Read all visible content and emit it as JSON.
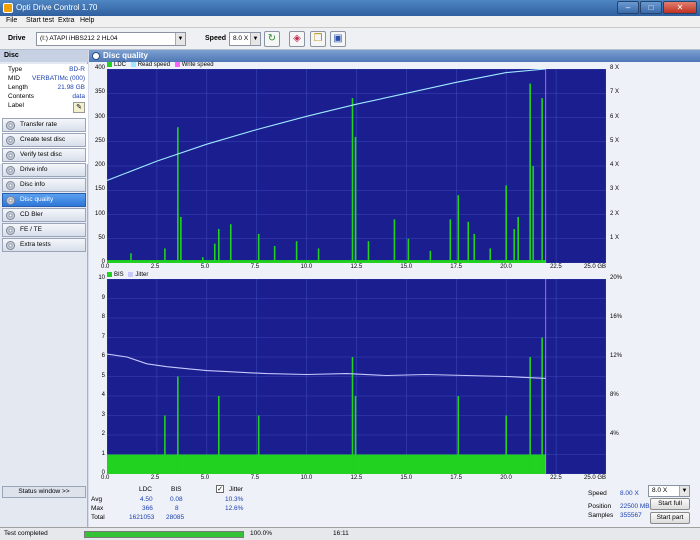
{
  "window": {
    "title": "Opti Drive Control 1.70",
    "minimize": "–",
    "maximize": "□",
    "close": "✕"
  },
  "menu": [
    "File",
    "Start test",
    "Extra",
    "Help"
  ],
  "toolbar": {
    "drive_label": "Drive",
    "drive_value": "(I:)  ATAPI iHBS212   2 HL04",
    "speed_label": "Speed",
    "speed_value": "8.0 X",
    "refresh_icon": "refresh-icon",
    "erase_icon": "erase-icon",
    "copy_icon": "copy-icon",
    "save_icon": "save-icon"
  },
  "sidebar": {
    "header": "Disc",
    "info": [
      {
        "key": "Type",
        "value": "BD-R"
      },
      {
        "key": "MID",
        "value": "VERBATIMc (000)"
      },
      {
        "key": "Length",
        "value": "21.98 GB"
      },
      {
        "key": "Contents",
        "value": "data"
      },
      {
        "key": "Label",
        "value": ""
      }
    ],
    "nav": [
      {
        "label": "Transfer rate",
        "active": false
      },
      {
        "label": "Create test disc",
        "active": false
      },
      {
        "label": "Verify test disc",
        "active": false
      },
      {
        "label": "Drive info",
        "active": false
      },
      {
        "label": "Disc info",
        "active": false
      },
      {
        "label": "Disc quality",
        "active": true
      },
      {
        "label": "CD Bler",
        "active": false
      },
      {
        "label": "FE / TE",
        "active": false
      },
      {
        "label": "Extra tests",
        "active": false
      }
    ],
    "status_window": "Status window >>"
  },
  "panel": {
    "title": "Disc quality"
  },
  "chart_data": [
    {
      "type": "area",
      "legend": [
        "LDC",
        "Read speed",
        "Write speed"
      ],
      "colors": {
        "ldc": "#21d221",
        "read": "#9fe8ff",
        "write": "#ff60ff",
        "bg": "#1a1e8e",
        "grid": "#3a47b8"
      },
      "x_ticks": [
        "0.0",
        "2.5",
        "5.0",
        "7.5",
        "10.0",
        "12.5",
        "15.0",
        "17.5",
        "20.0",
        "22.5",
        "25.0 GB"
      ],
      "y_ticks": [
        "0",
        "50",
        "100",
        "150",
        "200",
        "250",
        "300",
        "350",
        "400"
      ],
      "y2_ticks": [
        "1 X",
        "2 X",
        "3 X",
        "4 X",
        "5 X",
        "6 X",
        "7 X",
        "8 X"
      ],
      "xlim": [
        0,
        25
      ],
      "ylim": [
        0,
        400
      ],
      "y2lim": [
        0,
        8
      ],
      "end_gb": 21.98,
      "baseline": 6,
      "read_speed": {
        "x": [
          0,
          2.5,
          5,
          7.5,
          10,
          12.5,
          15,
          17.5,
          20,
          21.98
        ],
        "y": [
          3.4,
          4.2,
          4.9,
          5.5,
          6.05,
          6.55,
          7.0,
          7.45,
          7.85,
          8.0
        ]
      },
      "spikes": {
        "x": [
          1.2,
          2.9,
          3.55,
          3.7,
          4.8,
          5.4,
          5.6,
          6.2,
          7.6,
          8.4,
          9.5,
          10.6,
          12.3,
          12.45,
          13.1,
          14.4,
          15.1,
          16.2,
          17.2,
          17.6,
          18.1,
          18.4,
          19.2,
          20.0,
          20.4,
          20.6,
          21.2,
          21.35,
          21.8
        ],
        "y": [
          20,
          30,
          280,
          95,
          12,
          40,
          70,
          80,
          60,
          35,
          45,
          30,
          340,
          260,
          45,
          90,
          50,
          25,
          90,
          140,
          85,
          60,
          30,
          160,
          70,
          95,
          370,
          200,
          340
        ]
      }
    },
    {
      "type": "area",
      "legend": [
        "BIS",
        "Jitter"
      ],
      "colors": {
        "bis": "#21d221",
        "jitter": "#c8c8ff",
        "bg": "#1a1e8e",
        "grid": "#3a47b8"
      },
      "x_ticks": [
        "0.0",
        "2.5",
        "5.0",
        "7.5",
        "10.0",
        "12.5",
        "15.0",
        "17.5",
        "20.0",
        "22.5",
        "25.0 GB"
      ],
      "y_ticks": [
        "0",
        "1",
        "2",
        "3",
        "4",
        "5",
        "6",
        "7",
        "8",
        "9",
        "10"
      ],
      "y2_ticks": [
        "4%",
        "8%",
        "12%",
        "16%",
        "20%"
      ],
      "xlim": [
        0,
        25
      ],
      "ylim": [
        0,
        10
      ],
      "y2lim": [
        0,
        20
      ],
      "end_gb": 21.98,
      "baseline": 1,
      "jitter": {
        "x": [
          0,
          1,
          2,
          3,
          4,
          5,
          6,
          8,
          10,
          12,
          14,
          16,
          18,
          20,
          21.98
        ],
        "y": [
          12.3,
          12.0,
          11.3,
          11.0,
          10.8,
          10.6,
          10.5,
          10.3,
          10.2,
          10.3,
          10.1,
          10.2,
          10.1,
          10.0,
          9.8
        ]
      },
      "spikes": {
        "x": [
          2.9,
          3.55,
          5.6,
          7.6,
          12.3,
          12.45,
          17.6,
          20.0,
          21.2,
          21.8
        ],
        "y": [
          3,
          5,
          4,
          3,
          6,
          4,
          4,
          3,
          6,
          7
        ]
      }
    }
  ],
  "stats": {
    "col_ldc": "LDC",
    "col_bis": "BIS",
    "col_jitter": "Jitter",
    "rows": [
      {
        "label": "Avg",
        "ldc": "4.50",
        "bis": "0.08",
        "jitter": "10.3%"
      },
      {
        "label": "Max",
        "ldc": "366",
        "bis": "8",
        "jitter": "12.6%"
      },
      {
        "label": "Total",
        "ldc": "1621053",
        "bis": "28085",
        "jitter": ""
      }
    ],
    "jitter_checked": true,
    "speed_label": "Speed",
    "speed_value": "8.00 X",
    "speed_select": "8.0 X",
    "position_label": "Position",
    "position_value": "22500 MB",
    "samples_label": "Samples",
    "samples_value": "355567",
    "start_full": "Start full",
    "start_part": "Start part"
  },
  "statusbar": {
    "text": "Test completed",
    "progress": 100,
    "progress_text": "100.0%",
    "time": "16:11"
  }
}
